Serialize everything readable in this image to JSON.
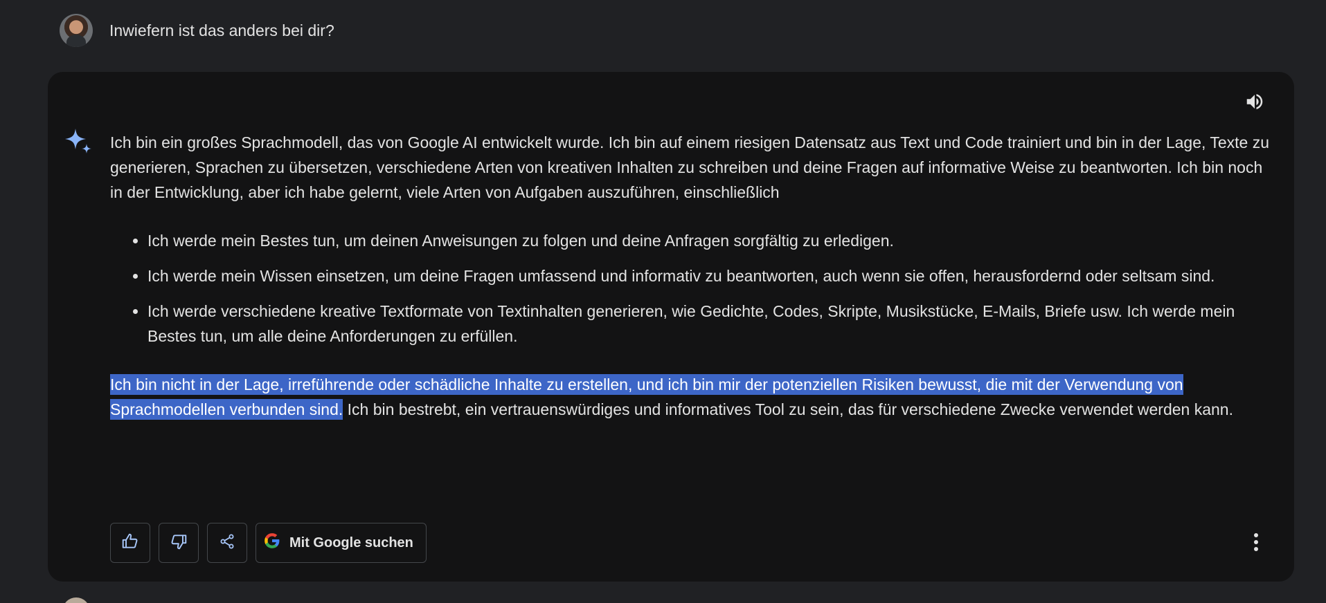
{
  "prompt": {
    "text": "Inwiefern ist das anders bei dir?"
  },
  "response": {
    "intro": "Ich bin ein großes Sprachmodell, das von Google AI entwickelt wurde. Ich bin auf einem riesigen Datensatz aus Text und Code trainiert und bin in der Lage, Texte zu generieren, Sprachen zu übersetzen, verschiedene Arten von kreativen Inhalten zu schreiben und deine Fragen auf informative Weise zu beantworten. Ich bin noch in der Entwicklung, aber ich habe gelernt, viele Arten von Aufgaben auszuführen, einschließlich",
    "bullets": [
      "Ich werde mein Bestes tun, um deinen Anweisungen zu folgen und deine Anfragen sorgfältig zu erledigen.",
      "Ich werde mein Wissen einsetzen, um deine Fragen umfassend und informativ zu beantworten, auch wenn sie offen, herausfordernd oder seltsam sind.",
      "Ich werde verschiedene kreative Textformate von Textinhalten generieren, wie Gedichte, Codes, Skripte, Musikstücke, E-Mails, Briefe usw. Ich werde mein Bestes tun, um alle deine Anforderungen zu erfüllen."
    ],
    "closing_selected": "Ich bin nicht in der Lage, irreführende oder schädliche Inhalte zu erstellen, und ich bin mir der potenziellen Risiken bewusst, die mit der Verwendung von Sprachmodellen verbunden sind.",
    "closing_rest": " Ich bin bestrebt, ein vertrauenswürdiges und informatives Tool zu sein, das für verschiedene Zwecke verwendet werden kann."
  },
  "actions": {
    "google_search_label": "Mit Google suchen"
  },
  "icons": {
    "sparkle": "sparkle-icon",
    "speaker": "speaker-icon",
    "thumbs_up": "thumbs-up-icon",
    "thumbs_down": "thumbs-down-icon",
    "share": "share-icon",
    "google": "google-g-icon",
    "more": "more-vert-icon"
  },
  "colors": {
    "background": "#202124",
    "card": "#131314",
    "selection": "#3d66c7",
    "sparkle": "#8ab4f8",
    "text": "#e3e3e3"
  }
}
